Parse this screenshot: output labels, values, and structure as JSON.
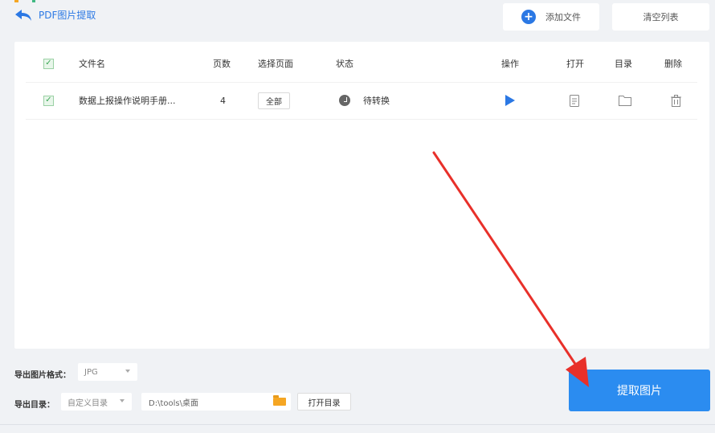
{
  "header": {
    "back_label": "PDF图片提取",
    "add_file_label": "添加文件",
    "clear_list_label": "清空列表"
  },
  "table": {
    "headers": {
      "filename": "文件名",
      "pages": "页数",
      "select_pages": "选择页面",
      "status": "状态",
      "action": "操作",
      "open": "打开",
      "directory": "目录",
      "delete": "删除"
    },
    "rows": [
      {
        "filename": "数据上报操作说明手册...",
        "pages": "4",
        "select_pages": "全部",
        "status": "待转换",
        "checked": true
      }
    ]
  },
  "footer": {
    "format_label": "导出图片格式：",
    "format_value": "JPG",
    "dir_label": "导出目录：",
    "dir_type_value": "自定义目录",
    "dir_path": "D:\\tools\\桌面",
    "open_dir_label": "打开目录",
    "extract_label": "提取图片"
  },
  "colors": {
    "accent": "#2b78e4",
    "primary_button": "#2b8cf0",
    "annotation_arrow": "#e8302a",
    "checkbox_green": "#3aa655"
  }
}
